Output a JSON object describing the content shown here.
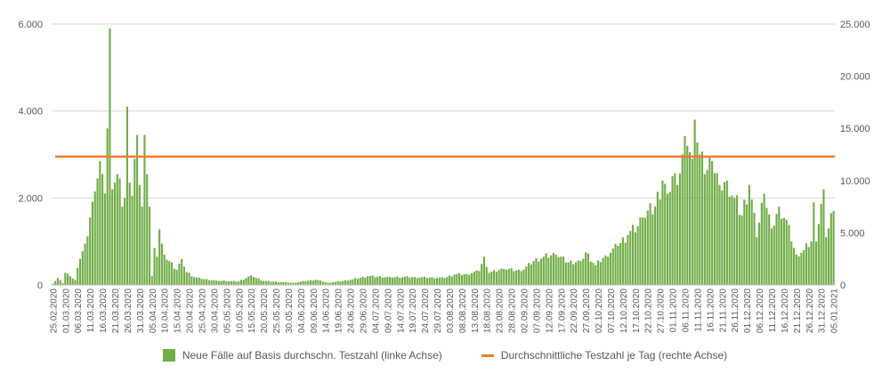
{
  "colors": {
    "bars": "#70ad47",
    "line": "#ed7d31",
    "grid": "#d9d9d9",
    "text": "#595959"
  },
  "chart_data": {
    "type": "bar",
    "grid": true,
    "legend_position": "bottom",
    "left_axis": {
      "ylim": [
        0,
        6000
      ],
      "ticks": [
        0,
        2000,
        4000,
        6000
      ],
      "tick_labels": [
        "0",
        "2.000",
        "4.000",
        "6.000"
      ]
    },
    "right_axis": {
      "ylim": [
        0,
        25000
      ],
      "ticks": [
        0,
        5000,
        10000,
        15000,
        20000,
        25000
      ],
      "tick_labels": [
        "0",
        "5.000",
        "10.000",
        "15.000",
        "20.000",
        "25.000"
      ]
    },
    "x_tick_labels": [
      "25.02.2020",
      "01.03.2020",
      "06.03.2020",
      "11.03.2020",
      "16.03.2020",
      "21.03.2020",
      "26.03.2020",
      "31.03.2020",
      "05.04.2020",
      "10.04.2020",
      "15.04.2020",
      "20.04.2020",
      "25.04.2020",
      "30.04.2020",
      "05.05.2020",
      "10.05.2020",
      "15.05.2020",
      "20.05.2020",
      "25.05.2020",
      "30.05.2020",
      "04.06.2020",
      "09.06.2020",
      "14.06.2020",
      "19.06.2020",
      "24.06.2020",
      "29.06.2020",
      "04.07.2020",
      "09.07.2020",
      "14.07.2020",
      "19.07.2020",
      "24.07.2020",
      "29.07.2020",
      "03.08.2020",
      "08.08.2020",
      "13.08.2020",
      "18.08.2020",
      "23.08.2020",
      "28.08.2020",
      "02.09.2020",
      "07.09.2020",
      "12.09.2020",
      "17.09.2020",
      "22.09.2020",
      "27.09.2020",
      "02.10.2020",
      "07.10.2020",
      "12.10.2020",
      "17.10.2020",
      "22.10.2020",
      "27.10.2020",
      "01.11.2020",
      "06.11.2020",
      "11.11.2020",
      "16.11.2020",
      "21.11.2020",
      "26.11.2020",
      "01.12.2020",
      "06.12.2020",
      "11.12.2020",
      "16.12.2020",
      "21.12.2020",
      "26.12.2020",
      "31.12.2020",
      "05.01.2021"
    ],
    "series": [
      {
        "name": "Neue Fälle auf Basis durchschn. Testzahl (linke Achse)",
        "type": "bar",
        "axis": "left",
        "anchors": [
          [
            "2020-02-25",
            30
          ],
          [
            "2020-02-27",
            160
          ],
          [
            "2020-02-29",
            40
          ],
          [
            "2020-03-01",
            280
          ],
          [
            "2020-03-03",
            200
          ],
          [
            "2020-03-05",
            110
          ],
          [
            "2020-03-07",
            600
          ],
          [
            "2020-03-09",
            950
          ],
          [
            "2020-03-11",
            1550
          ],
          [
            "2020-03-13",
            2150
          ],
          [
            "2020-03-14",
            2450
          ],
          [
            "2020-03-15",
            2850
          ],
          [
            "2020-03-16",
            2550
          ],
          [
            "2020-03-17",
            2100
          ],
          [
            "2020-03-18",
            3600
          ],
          [
            "2020-03-19",
            5900
          ],
          [
            "2020-03-20",
            2200
          ],
          [
            "2020-03-21",
            2350
          ],
          [
            "2020-03-22",
            2550
          ],
          [
            "2020-03-23",
            2450
          ],
          [
            "2020-03-24",
            1800
          ],
          [
            "2020-03-25",
            2000
          ],
          [
            "2020-03-26",
            4100
          ],
          [
            "2020-03-27",
            2350
          ],
          [
            "2020-03-28",
            2050
          ],
          [
            "2020-03-29",
            2900
          ],
          [
            "2020-03-30",
            3450
          ],
          [
            "2020-03-31",
            2300
          ],
          [
            "2020-04-01",
            1800
          ],
          [
            "2020-04-02",
            3450
          ],
          [
            "2020-04-03",
            2550
          ],
          [
            "2020-04-04",
            1800
          ],
          [
            "2020-04-05",
            200
          ],
          [
            "2020-04-06",
            850
          ],
          [
            "2020-04-07",
            650
          ],
          [
            "2020-04-08",
            1280
          ],
          [
            "2020-04-09",
            950
          ],
          [
            "2020-04-10",
            700
          ],
          [
            "2020-04-12",
            550
          ],
          [
            "2020-04-15",
            350
          ],
          [
            "2020-04-17",
            600
          ],
          [
            "2020-04-19",
            300
          ],
          [
            "2020-04-22",
            180
          ],
          [
            "2020-04-25",
            140
          ],
          [
            "2020-05-01",
            100
          ],
          [
            "2020-05-10",
            80
          ],
          [
            "2020-05-15",
            220
          ],
          [
            "2020-05-20",
            90
          ],
          [
            "2020-06-01",
            50
          ],
          [
            "2020-06-10",
            120
          ],
          [
            "2020-06-15",
            50
          ],
          [
            "2020-06-20",
            80
          ],
          [
            "2020-06-25",
            130
          ],
          [
            "2020-07-01",
            200
          ],
          [
            "2020-07-10",
            180
          ],
          [
            "2020-07-20",
            180
          ],
          [
            "2020-08-01",
            160
          ],
          [
            "2020-08-05",
            240
          ],
          [
            "2020-08-10",
            250
          ],
          [
            "2020-08-15",
            320
          ],
          [
            "2020-08-17",
            650
          ],
          [
            "2020-08-19",
            280
          ],
          [
            "2020-08-25",
            370
          ],
          [
            "2020-09-01",
            320
          ],
          [
            "2020-09-06",
            550
          ],
          [
            "2020-09-10",
            650
          ],
          [
            "2020-09-15",
            700
          ],
          [
            "2020-09-20",
            520
          ],
          [
            "2020-09-25",
            550
          ],
          [
            "2020-09-27",
            750
          ],
          [
            "2020-10-01",
            450
          ],
          [
            "2020-10-05",
            680
          ],
          [
            "2020-10-10",
            900
          ],
          [
            "2020-10-14",
            1150
          ],
          [
            "2020-10-18",
            1350
          ],
          [
            "2020-10-20",
            1550
          ],
          [
            "2020-10-25",
            1800
          ],
          [
            "2020-10-28",
            2400
          ],
          [
            "2020-10-30",
            2100
          ],
          [
            "2020-11-01",
            2500
          ],
          [
            "2020-11-03",
            2300
          ],
          [
            "2020-11-05",
            3000
          ],
          [
            "2020-11-07",
            3200
          ],
          [
            "2020-11-09",
            2900
          ],
          [
            "2020-11-10",
            3800
          ],
          [
            "2020-11-12",
            3000
          ],
          [
            "2020-11-14",
            2550
          ],
          [
            "2020-11-17",
            2850
          ],
          [
            "2020-11-20",
            2300
          ],
          [
            "2020-11-23",
            2400
          ],
          [
            "2020-11-26",
            2000
          ],
          [
            "2020-11-29",
            1600
          ],
          [
            "2020-12-02",
            2300
          ],
          [
            "2020-12-05",
            1100
          ],
          [
            "2020-12-08",
            2100
          ],
          [
            "2020-12-11",
            1300
          ],
          [
            "2020-12-14",
            1800
          ],
          [
            "2020-12-17",
            1500
          ],
          [
            "2020-12-19",
            1000
          ],
          [
            "2020-12-21",
            700
          ],
          [
            "2020-12-24",
            800
          ],
          [
            "2020-12-27",
            1000
          ],
          [
            "2020-12-28",
            1900
          ],
          [
            "2020-12-29",
            1000
          ],
          [
            "2020-12-30",
            1400
          ],
          [
            "2021-01-01",
            2200
          ],
          [
            "2021-01-02",
            1100
          ],
          [
            "2021-01-03",
            1300
          ],
          [
            "2021-01-04",
            1650
          ],
          [
            "2021-01-05",
            1700
          ]
        ]
      },
      {
        "name": "Durchschnittliche Testzahl je Tag (rechte Achse)",
        "type": "line",
        "axis": "right",
        "value": 12300
      }
    ]
  }
}
